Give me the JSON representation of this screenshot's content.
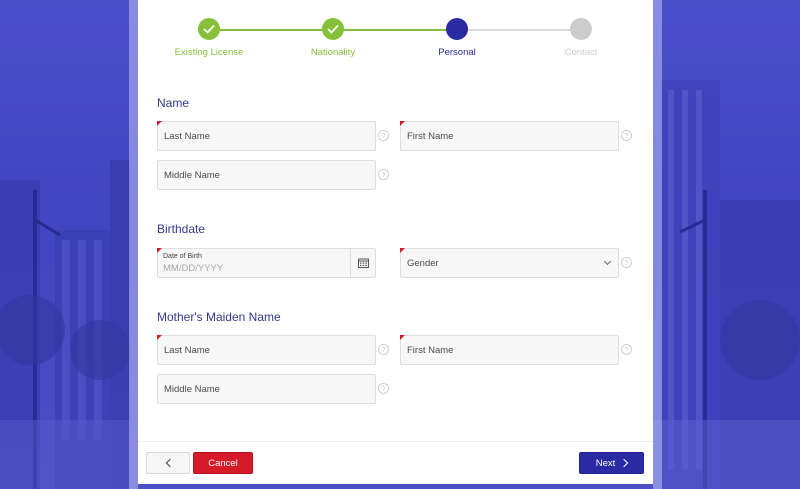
{
  "stepper": {
    "steps": [
      {
        "label": "Existing License",
        "state": "done",
        "color": "#86c03a"
      },
      {
        "label": "Nationality",
        "state": "done",
        "color": "#86c03a"
      },
      {
        "label": "Personal",
        "state": "current",
        "color": "#2a2ba3"
      },
      {
        "label": "Contact",
        "state": "pending",
        "color": "#cccccc"
      }
    ]
  },
  "sections": {
    "name": {
      "title": "Name",
      "last_name": "Last Name",
      "first_name": "First Name",
      "middle_name": "Middle Name"
    },
    "birthdate": {
      "title": "Birthdate",
      "dob_label": "Date of Birth",
      "dob_placeholder": "MM/DD/YYYY",
      "gender_label": "Gender"
    },
    "mother": {
      "title": "Mother's Maiden Name",
      "last_name": "Last Name",
      "first_name": "First Name",
      "middle_name": "Middle Name"
    }
  },
  "help_glyph": "?",
  "footer": {
    "cancel_label": "Cancel",
    "next_label": "Next"
  },
  "icons": {
    "check": "check-icon",
    "calendar": "calendar-icon",
    "help": "help-icon",
    "chevron_down": "chevron-down-icon",
    "chevron_left": "chevron-left-icon",
    "chevron_right": "chevron-right-icon"
  },
  "colors": {
    "accent": "#2a2ba3",
    "done": "#86c03a",
    "pending": "#cccccc",
    "cancel": "#d71a28",
    "section_title": "#35378f",
    "required_marker": "#d21f2d"
  }
}
